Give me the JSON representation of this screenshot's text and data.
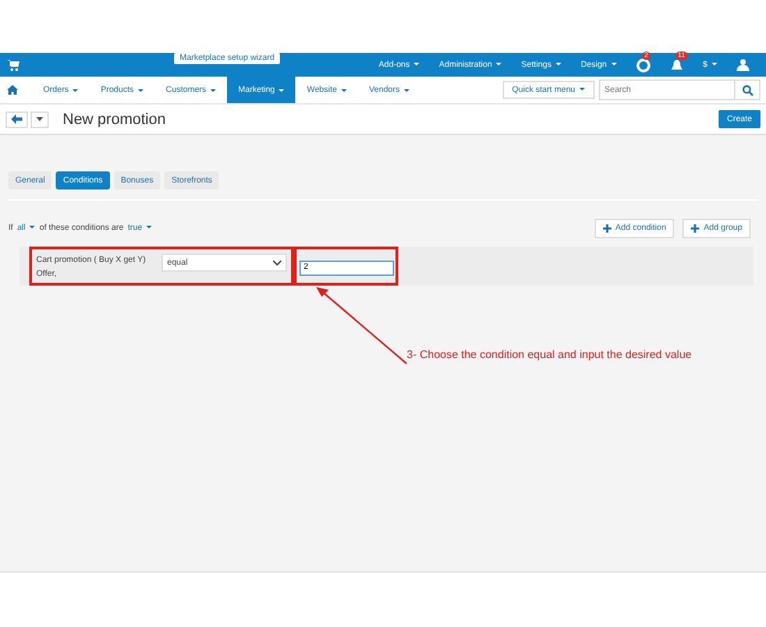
{
  "wizard_label": "Marketplace setup wizard",
  "top_menu": [
    {
      "label": "Add-ons"
    },
    {
      "label": "Administration"
    },
    {
      "label": "Settings"
    },
    {
      "label": "Design"
    }
  ],
  "badges": [
    {
      "count": "2",
      "kind": "lifebuoy"
    },
    {
      "count": "11",
      "kind": "bell"
    }
  ],
  "currency": "$",
  "nav": [
    {
      "label": "Orders",
      "selected": false
    },
    {
      "label": "Products",
      "selected": false
    },
    {
      "label": "Customers",
      "selected": false
    },
    {
      "label": "Marketing",
      "selected": true
    },
    {
      "label": "Website",
      "selected": false
    },
    {
      "label": "Vendors",
      "selected": false
    }
  ],
  "quick_start": "Quick start menu",
  "search": {
    "placeholder": "Search"
  },
  "page_title": "New promotion",
  "create_button": "Create",
  "tabs": [
    {
      "label": "General",
      "selected": false
    },
    {
      "label": "Conditions",
      "selected": true
    },
    {
      "label": "Bonuses",
      "selected": false
    },
    {
      "label": "Storefronts",
      "selected": false
    }
  ],
  "rule": {
    "prefix": "If",
    "mode": "all",
    "middle": "of these conditions are",
    "value": "true"
  },
  "actions": [
    "Add condition",
    "Add group"
  ],
  "condition": {
    "name": "Cart promotion ( Buy X get Y) Offer,",
    "operator": "equal",
    "value": "2"
  },
  "annotation": "3- Choose the condition equal and input the desired value"
}
